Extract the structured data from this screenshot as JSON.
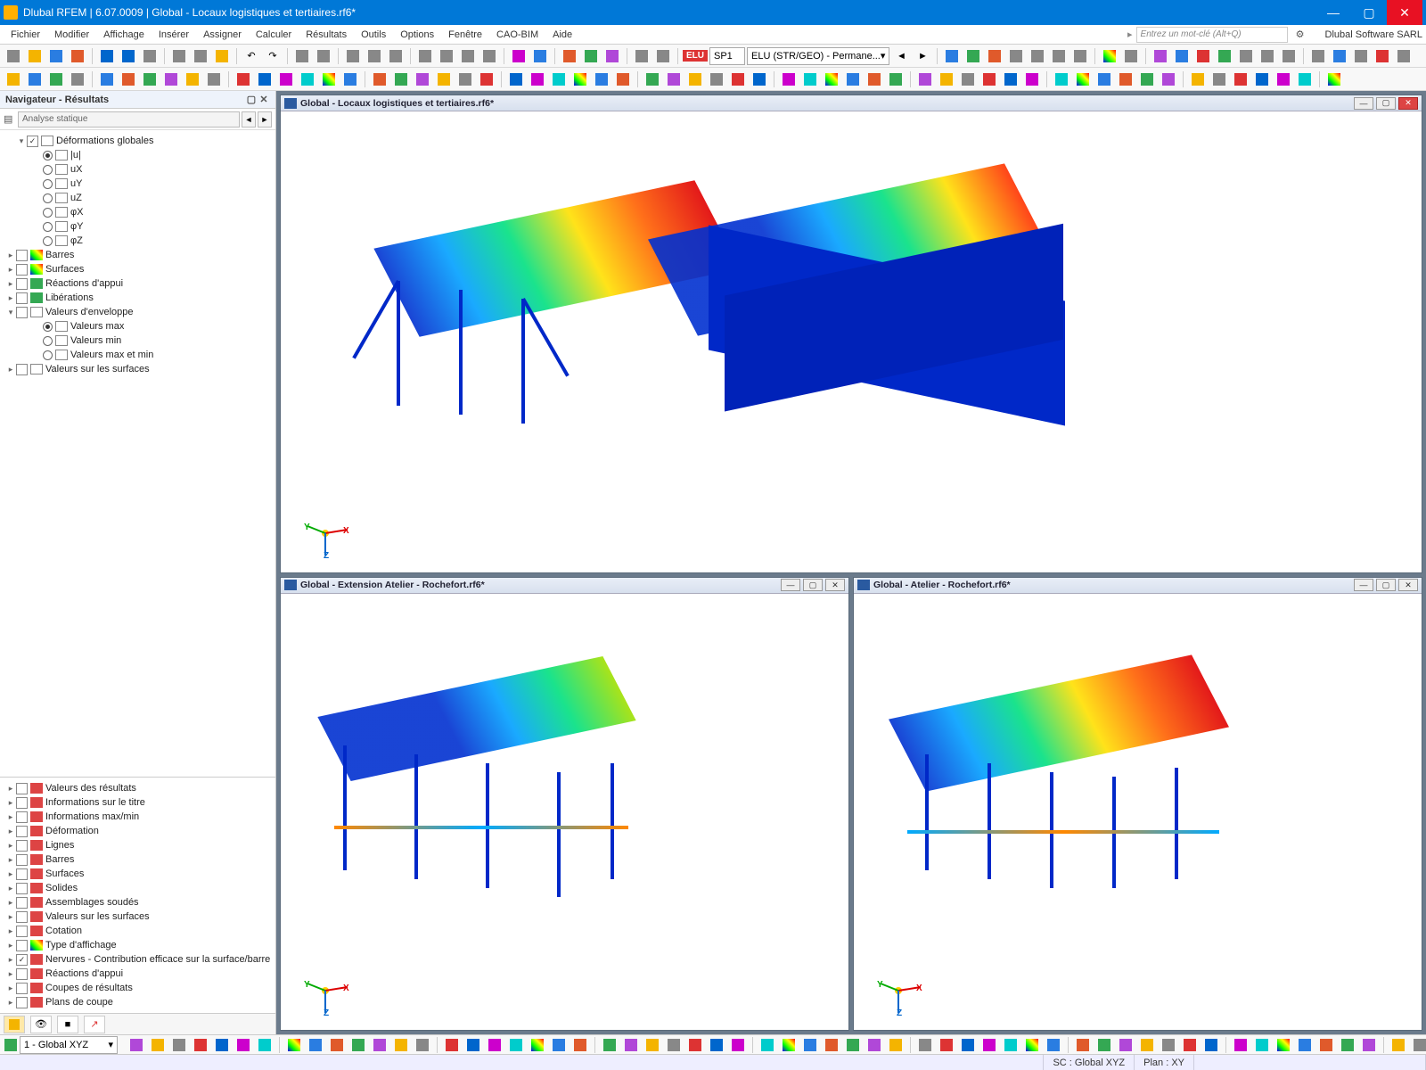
{
  "title": "Dlubal RFEM | 6.07.0009 | Global - Locaux logistiques et tertiaires.rf6*",
  "brand": "Dlubal Software SARL",
  "search_placeholder": "Entrez un mot-clé (Alt+Q)",
  "menu": [
    "Fichier",
    "Modifier",
    "Affichage",
    "Insérer",
    "Assigner",
    "Calculer",
    "Résultats",
    "Outils",
    "Options",
    "Fenêtre",
    "CAO-BIM",
    "Aide"
  ],
  "toolbar2": {
    "elu_tag": "ELU",
    "sp_value": "SP1",
    "combo_value": "ELU (STR/GEO) - Permane..."
  },
  "navigator": {
    "title": "Navigateur - Résultats",
    "combo": "Analyse statique",
    "tree_top": [
      {
        "type": "group",
        "checked": true,
        "expander": "v",
        "label": "Déformations globales",
        "d": 1
      },
      {
        "type": "radio",
        "sel": true,
        "label": "|u|",
        "d": 2
      },
      {
        "type": "radio",
        "sel": false,
        "label": "uX",
        "d": 2
      },
      {
        "type": "radio",
        "sel": false,
        "label": "uY",
        "d": 2
      },
      {
        "type": "radio",
        "sel": false,
        "label": "uZ",
        "d": 2
      },
      {
        "type": "radio",
        "sel": false,
        "label": "φX",
        "d": 2
      },
      {
        "type": "radio",
        "sel": false,
        "label": "φY",
        "d": 2
      },
      {
        "type": "radio",
        "sel": false,
        "label": "φZ",
        "d": 2
      },
      {
        "type": "group",
        "checked": false,
        "expander": ">",
        "label": "Barres",
        "d": 0,
        "icon": "grad"
      },
      {
        "type": "group",
        "checked": false,
        "expander": ">",
        "label": "Surfaces",
        "d": 0,
        "icon": "grad"
      },
      {
        "type": "group",
        "checked": false,
        "expander": ">",
        "label": "Réactions d'appui",
        "d": 0,
        "icon": "sw3"
      },
      {
        "type": "group",
        "checked": false,
        "expander": ">",
        "label": "Libérations",
        "d": 0,
        "icon": "sw3"
      },
      {
        "type": "group",
        "checked": false,
        "expander": "v",
        "label": "Valeurs d'enveloppe",
        "d": 0
      },
      {
        "type": "radio",
        "sel": true,
        "label": "Valeurs max",
        "d": 2
      },
      {
        "type": "radio",
        "sel": false,
        "label": "Valeurs min",
        "d": 2
      },
      {
        "type": "radio",
        "sel": false,
        "label": "Valeurs max et min",
        "d": 2
      },
      {
        "type": "group",
        "checked": false,
        "expander": ">",
        "label": "Valeurs sur les surfaces",
        "d": 0
      }
    ],
    "tree_bottom": [
      {
        "checked": false,
        "label": "Valeurs des résultats"
      },
      {
        "checked": false,
        "label": "Informations sur le titre"
      },
      {
        "checked": false,
        "label": "Informations max/min"
      },
      {
        "checked": false,
        "label": "Déformation"
      },
      {
        "checked": false,
        "label": "Lignes"
      },
      {
        "checked": false,
        "label": "Barres"
      },
      {
        "checked": false,
        "label": "Surfaces"
      },
      {
        "checked": false,
        "label": "Solides"
      },
      {
        "checked": false,
        "label": "Assemblages soudés"
      },
      {
        "checked": false,
        "label": "Valeurs sur les surfaces"
      },
      {
        "checked": false,
        "label": "Cotation"
      },
      {
        "checked": false,
        "label": "Type d'affichage",
        "icon": "grad"
      },
      {
        "checked": true,
        "label": "Nervures - Contribution efficace sur la surface/barre"
      },
      {
        "checked": false,
        "label": "Réactions d'appui"
      },
      {
        "checked": false,
        "label": "Coupes de résultats"
      },
      {
        "checked": false,
        "label": "Plans de coupe"
      }
    ]
  },
  "views": {
    "main": "Global - Locaux logistiques et tertiaires.rf6*",
    "bl": "Global - Extension Atelier - Rochefort.rf6*",
    "br": "Global - Atelier - Rochefort.rf6*"
  },
  "axis": {
    "x": "X",
    "y": "Y",
    "z": "Z"
  },
  "bottom_combo": "1 - Global XYZ",
  "status": {
    "sc": "SC : Global XYZ",
    "plan": "Plan : XY"
  }
}
